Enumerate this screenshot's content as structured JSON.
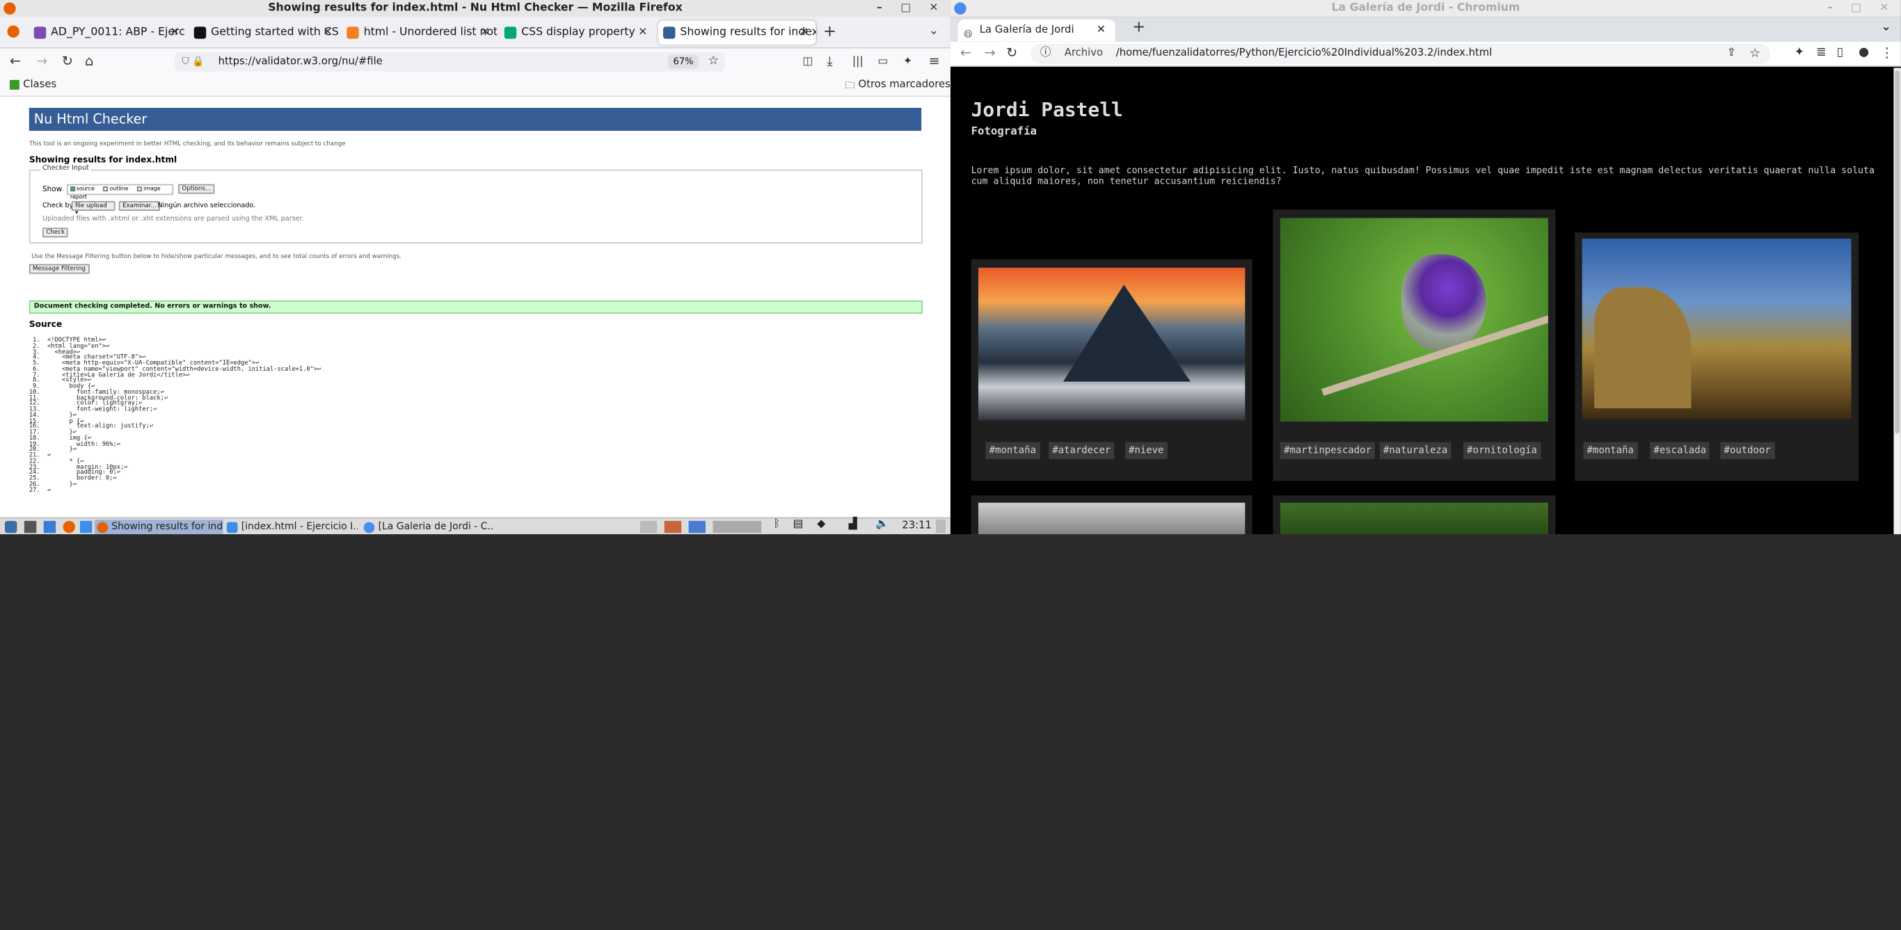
{
  "firefox": {
    "window_title": "Showing results for index.html - Nu Html Checker — Mozilla Firefox",
    "tabs": [
      {
        "label": "AD_PY_0011: ABP - Ejerc",
        "color": "#7b4db2"
      },
      {
        "label": "Getting started with CSS",
        "color": "#111111"
      },
      {
        "label": "html - Unordered list not",
        "color": "#f48024"
      },
      {
        "label": "CSS display property",
        "color": "#04aa6d"
      },
      {
        "label": "Showing results for index",
        "color": "#365d95"
      }
    ],
    "url": "https://validator.w3.org/nu/#file",
    "zoom": "67%",
    "bookmarks": {
      "left": "Clases",
      "right": "Otros marcadores"
    },
    "page": {
      "header": "Nu Html Checker",
      "experiment": "This tool is an ongoing experiment in better HTML checking, and its behavior remains subject to change",
      "showing": "Showing results for index.html",
      "checker_input": "Checker Input",
      "show": "Show",
      "opt_source": "source",
      "opt_outline": "outline",
      "opt_image": "image report",
      "options_btn": "Options...",
      "check_by": "Check by",
      "check_by_value": "file upload",
      "browse_btn": "Examinar...",
      "no_file": "Ningún archivo seleccionado.",
      "xml_note": "Uploaded files with .xhtml or .xht extensions are parsed using the XML parser.",
      "check_btn": "Check",
      "filter_note": "Use the Message Filtering button below to hide/show particular messages, and to see total counts of errors and warnings.",
      "filter_btn": "Message Filtering",
      "status": "Document checking completed. No errors or warnings to show.",
      "source_heading": "Source",
      "code": " 1.  <!DOCTYPE html>↩\n 2.  <html lang=\"en\">↩\n 3.    <head>↩\n 4.      <meta charset=\"UTF-8\">↩\n 5.      <meta http-equiv=\"X-UA-Compatible\" content=\"IE=edge\">↩\n 6.      <meta name=\"viewport\" content=\"width=device-width, initial-scale=1.0\">↩\n 7.      <title>La Galería de Jordi</title>↩\n 8.      <style>↩\n 9.        body {↩\n10.          font-family: monospace;↩\n11.          background-color: black;↩\n12.          color: lightgray;↩\n13.          font-weight: lighter;↩\n14.        }↩\n15.        p {↩\n16.          text-align: justify;↩\n17.        }↩\n18.        img {↩\n19.          width: 96%;↩\n20.        }↩\n21.  ↩\n22.        * {↩\n23.          margin: 10px;↩\n24.          padding: 0;↩\n25.          border: 0;↩\n26.        }↩\n27.  ↩"
    }
  },
  "taskbar": {
    "items": [
      "Showing results for ind...",
      "[index.html - Ejercicio I...",
      "[La Galeria de Jordi - C..."
    ],
    "clock": "23:11"
  },
  "chromium": {
    "window_title": "La Galería de Jordi - Chromium",
    "tab": "La Galería de Jordi",
    "url_prefix": "Archivo",
    "url": "/home/fuenzalidatorres/Python/Ejercicio%20Individual%203.2/index.html",
    "page": {
      "title": "Jordi Pastell",
      "subtitle": "Fotografía",
      "lorem": "Lorem ipsum dolor, sit amet consectetur adipisicing elit. Iusto, natus quibusdam! Possimus vel quae impedit iste est magnam delectus veritatis quaerat nulla soluta cum aliquid maiores, non tenetur accusantium reiciendis?",
      "cards": [
        {
          "tags": [
            "#montaña",
            "#atardecer",
            "#nieve"
          ]
        },
        {
          "tags": [
            "#martinpescador",
            "#naturaleza",
            "#ornitología"
          ]
        },
        {
          "tags": [
            "#montaña",
            "#escalada",
            "#outdoor"
          ]
        }
      ]
    }
  }
}
